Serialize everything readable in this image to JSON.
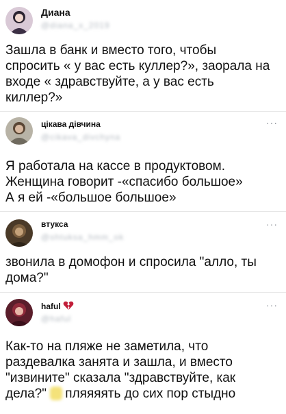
{
  "posts": [
    {
      "author": "Диана",
      "handle": "@diana_x_2019",
      "more": "···",
      "lines": [
        "Зашла в банк и вместо того, чтобы",
        "спросить « у вас есть куллер?», заорала на",
        "входе « здравствуйте, а у вас есть",
        "киллер?»"
      ]
    },
    {
      "author": "цікава дівчина",
      "handle": "@cikava_divchyna",
      "more": "···",
      "lines": [
        "Я работала на кассе в продуктовом.",
        "Женщина говорит -«спасибо большое»",
        "А я ей -«большое большое»"
      ]
    },
    {
      "author": "втукса",
      "handle": "@shtuksa_hmm_ok",
      "more": "···",
      "lines": [
        "звонила в домофон и спросила \"алло, ты",
        "дома?\""
      ]
    },
    {
      "author": "haful",
      "handle": "@haful",
      "more": "···",
      "lines": [
        "Как-то на пляже не заметила, что",
        "раздевалка занята и зашла, и вместо",
        "\"извините\" сказала \"здравствуйте, как",
        "дела?\"",
        "пляяяять до сих пор стыдно"
      ]
    }
  ],
  "icons": {
    "heart": "broken-heart-icon",
    "more": "more-options-icon"
  },
  "colors": {
    "heart": "#c21f3a",
    "divider": "#e6e6e6",
    "muted": "#8a8f96"
  }
}
